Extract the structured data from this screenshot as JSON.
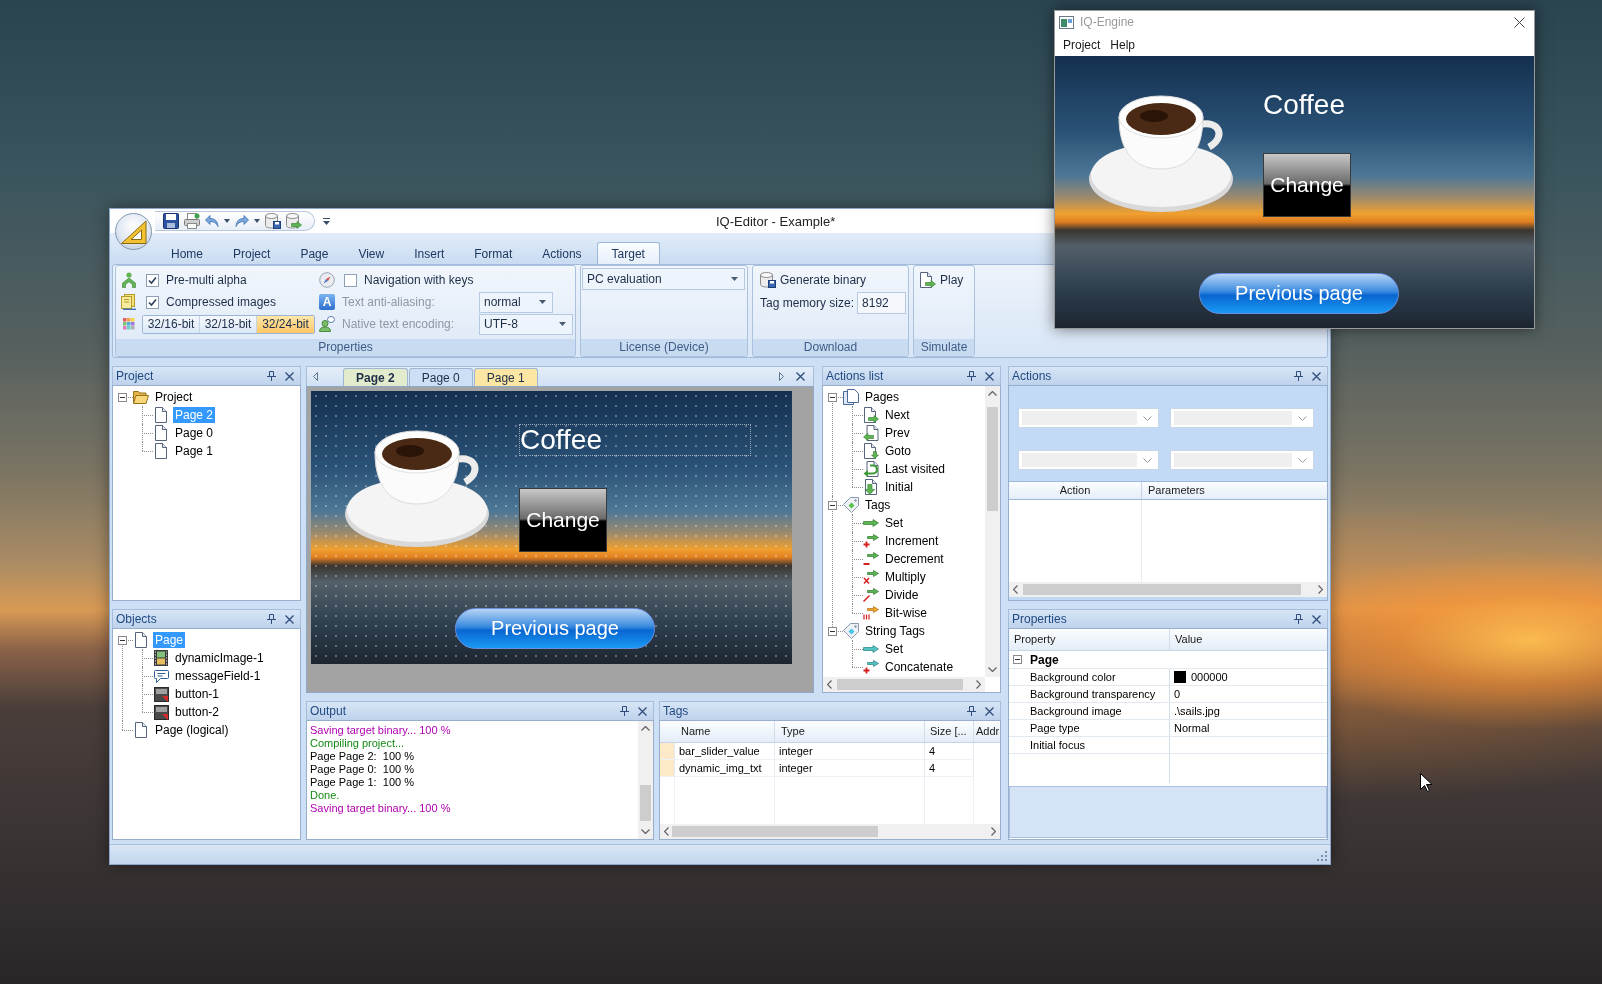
{
  "engine_window": {
    "title": "IQ-Engine",
    "menu": [
      "Project",
      "Help"
    ],
    "screen": {
      "heading": "Coffee",
      "change_button": "Change",
      "previous_button": "Previous page"
    }
  },
  "editor_window": {
    "title": "IQ-Editor - Example*"
  },
  "ribbon": {
    "tabs": [
      {
        "label": "Home",
        "selected": false
      },
      {
        "label": "Project",
        "selected": false
      },
      {
        "label": "Page",
        "selected": false
      },
      {
        "label": "View",
        "selected": false
      },
      {
        "label": "Insert",
        "selected": false
      },
      {
        "label": "Format",
        "selected": false
      },
      {
        "label": "Actions",
        "selected": false
      },
      {
        "label": "Target",
        "selected": true
      }
    ],
    "groups": [
      {
        "kind": "properties",
        "label": "Properties",
        "items": [
          {
            "kind": "checkbox",
            "label": "Pre-multi alpha",
            "checked": true
          },
          {
            "kind": "checkbox",
            "label": "Compressed images",
            "checked": true
          },
          {
            "kind": "segmented",
            "options": [
              {
                "label": "32/16-bit",
                "selected": false
              },
              {
                "label": "32/18-bit",
                "selected": false
              },
              {
                "label": "32/24-bit",
                "selected": true
              }
            ]
          },
          {
            "kind": "checkbox",
            "label": "Navigation with keys",
            "checked": false
          },
          {
            "kind": "dropdown",
            "icon": "A",
            "label": "Text anti-aliasing:",
            "value": "normal",
            "disabled": true
          },
          {
            "kind": "dropdown",
            "label": "Native text encoding:",
            "value": "UTF-8",
            "disabled": true
          }
        ]
      },
      {
        "kind": "license",
        "label": "License (Device)",
        "value": "PC evaluation"
      },
      {
        "kind": "download",
        "label": "Download",
        "button": "Generate binary",
        "field_label": "Tag memory size:",
        "field_value": "8192"
      },
      {
        "kind": "simulate",
        "label": "Simulate",
        "button": "Play"
      }
    ]
  },
  "project_panel": {
    "title": "Project",
    "tree": [
      {
        "label": "Project",
        "kind": "folder",
        "expanded": true,
        "selected": false,
        "children": [
          {
            "label": "Page 2",
            "kind": "page",
            "selected": true
          },
          {
            "label": "Page 0",
            "kind": "page",
            "selected": false
          },
          {
            "label": "Page 1",
            "kind": "page",
            "selected": false
          }
        ]
      }
    ]
  },
  "document": {
    "tabs": [
      {
        "label": "Page 2",
        "selected": true,
        "color": "#e2ebcb"
      },
      {
        "label": "Page 0",
        "selected": false,
        "color": "#cddff5"
      },
      {
        "label": "Page 1",
        "selected": false,
        "color": "#fbe7a3"
      }
    ],
    "screen": {
      "heading": "Coffee",
      "change_button": "Change",
      "previous_button": "Previous page"
    }
  },
  "actions_list": {
    "title": "Actions list",
    "tree": [
      {
        "label": "Pages",
        "kind": "pages",
        "expanded": true,
        "selected": false,
        "children": [
          {
            "label": "Next",
            "kind": "page-next",
            "selected": false
          },
          {
            "label": "Prev",
            "kind": "page-prev",
            "selected": false
          },
          {
            "label": "Goto",
            "kind": "page-goto",
            "selected": false
          },
          {
            "label": "Last visited",
            "kind": "page-last",
            "selected": false
          },
          {
            "label": "Initial",
            "kind": "page-initial",
            "selected": false
          }
        ]
      },
      {
        "label": "Tags",
        "kind": "tags",
        "expanded": true,
        "selected": false,
        "children": [
          {
            "label": "Set",
            "kind": "tag-set",
            "selected": false
          },
          {
            "label": "Increment",
            "kind": "tag-increment",
            "selected": false
          },
          {
            "label": "Decrement",
            "kind": "tag-decrement",
            "selected": false
          },
          {
            "label": "Multiply",
            "kind": "tag-multiply",
            "selected": false
          },
          {
            "label": "Divide",
            "kind": "tag-divide",
            "selected": false
          },
          {
            "label": "Bit-wise",
            "kind": "tag-bitwise",
            "selected": false
          }
        ]
      },
      {
        "label": "String Tags",
        "kind": "string-tags",
        "expanded": true,
        "selected": false,
        "children": [
          {
            "label": "Set",
            "kind": "string-set",
            "selected": false
          },
          {
            "label": "Concatenate",
            "kind": "string-concatenate",
            "selected": false
          }
        ]
      }
    ]
  },
  "actions_panel": {
    "title": "Actions",
    "columns": [
      "Action",
      "Parameters"
    ]
  },
  "objects_panel": {
    "title": "Objects",
    "tree": [
      {
        "label": "Page",
        "kind": "page",
        "expanded": true,
        "selected": true,
        "children": [
          {
            "label": "dynamicImage-1",
            "kind": "image",
            "selected": false
          },
          {
            "label": "messageField-1",
            "kind": "message",
            "selected": false
          },
          {
            "label": "button-1",
            "kind": "button",
            "selected": false
          },
          {
            "label": "button-2",
            "kind": "button",
            "selected": false
          }
        ]
      },
      {
        "label": "Page (logical)",
        "kind": "page",
        "selected": false
      }
    ]
  },
  "output_panel": {
    "title": "Output",
    "lines": [
      {
        "text": "Saving target binary... 100 %",
        "kind": "save"
      },
      {
        "text": "Compiling project...",
        "kind": "info"
      },
      {
        "text": "Page Page 2:  100 %",
        "kind": "detail"
      },
      {
        "text": "Page Page 0:  100 %",
        "kind": "detail"
      },
      {
        "text": "Page Page 1:  100 %",
        "kind": "detail"
      },
      {
        "text": "Done.",
        "kind": "info"
      },
      {
        "text": "Saving target binary... 100 %",
        "kind": "save"
      }
    ]
  },
  "tags_panel": {
    "title": "Tags",
    "columns": [
      "Name",
      "Type",
      "Size [...",
      "Addr"
    ],
    "rows": [
      [
        "bar_slider_value",
        "integer",
        "4"
      ],
      [
        "dynamic_img_txt",
        "integer",
        "4"
      ]
    ]
  },
  "properties_panel": {
    "title": "Properties",
    "columns": [
      "Property",
      "Value"
    ],
    "groups": [
      {
        "label": "Page",
        "expanded": true,
        "rows": [
          {
            "name": "Background color",
            "value": "000000",
            "color": "#000000"
          },
          {
            "name": "Background transparency",
            "value": "0"
          },
          {
            "name": "Background image",
            "value": ".\\sails.jpg"
          },
          {
            "name": "Page type",
            "value": "Normal"
          },
          {
            "name": "Initial focus"
          }
        ]
      }
    ]
  }
}
